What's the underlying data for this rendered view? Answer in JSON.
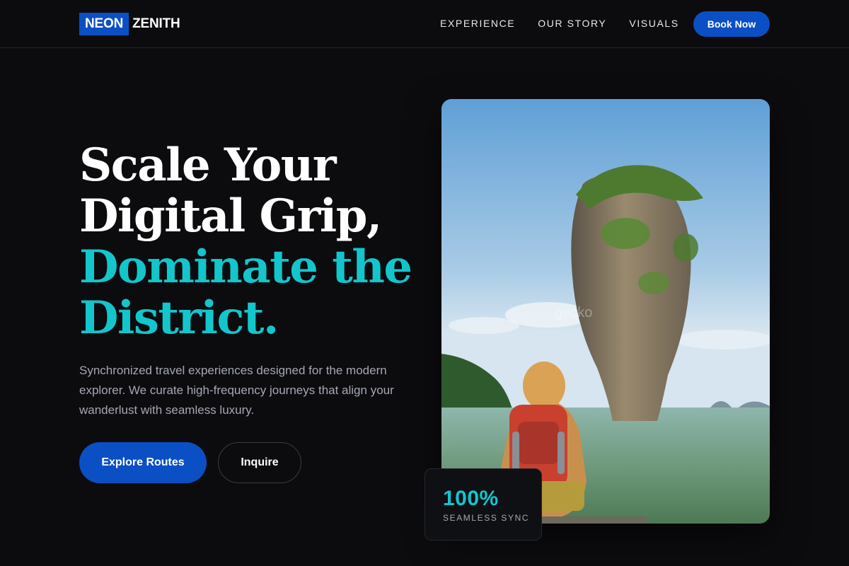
{
  "nav": {
    "logo": {
      "part1": "NEON",
      "part2": "ZENITH"
    },
    "links": [
      "EXPERIENCE",
      "OUR STORY",
      "VISUALS"
    ],
    "cta_label": "Book Now"
  },
  "hero": {
    "headline_white": [
      "Scale Your",
      "Digital Grip,"
    ],
    "headline_accent": [
      "Dominate the",
      "District."
    ],
    "subtext": "Synchronized travel experiences designed for the modern explorer. We curate high-frequency journeys that align your wanderlust with seamless luxury.",
    "primary_cta": "Explore Routes",
    "secondary_cta": "Inquire"
  },
  "stat": {
    "value": "100%",
    "label": "SEAMLESS SYNC"
  },
  "colors": {
    "background": "#0c0c0f",
    "brand_blue": "#0b4fc4",
    "accent_teal": "#12c6cc",
    "muted_text": "#a5a8b2"
  }
}
